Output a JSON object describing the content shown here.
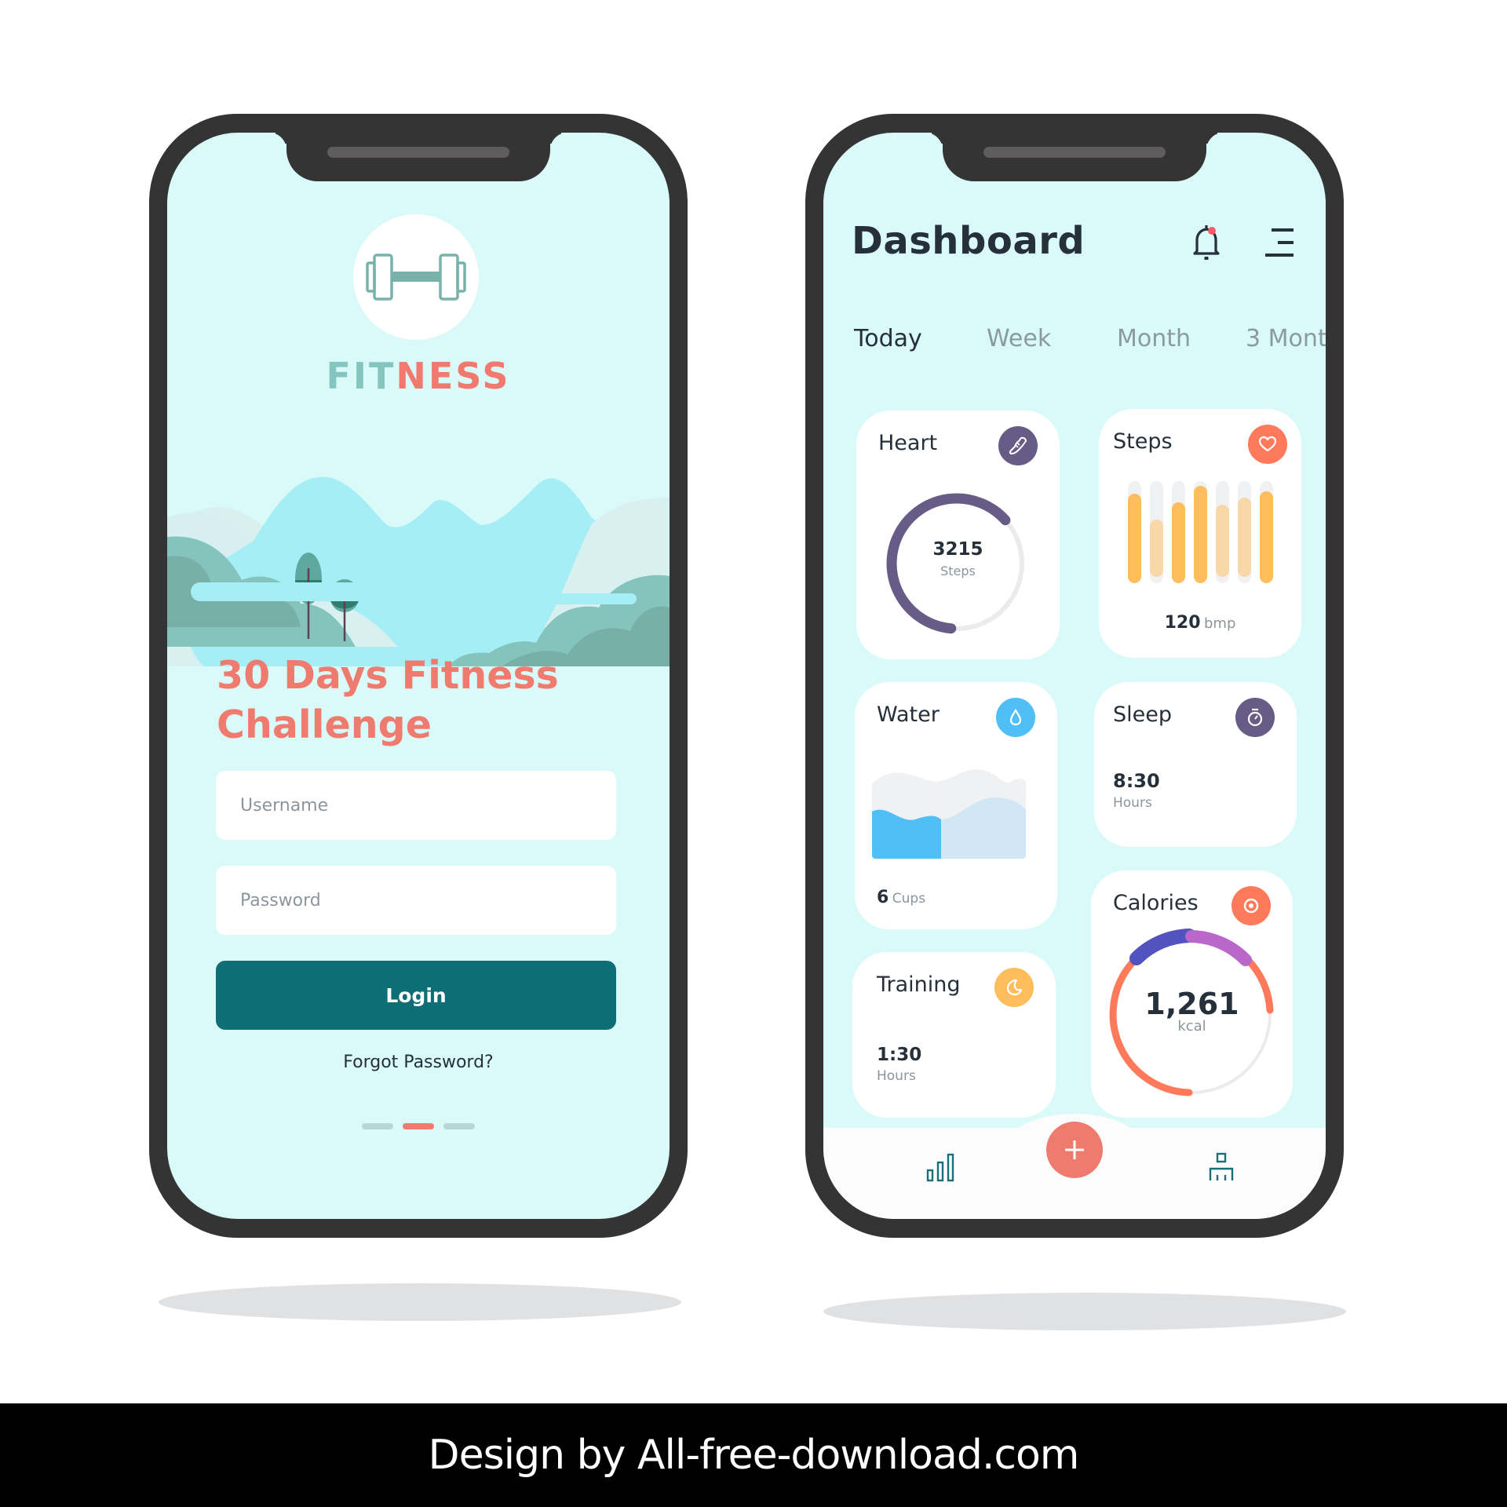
{
  "login_screen": {
    "brand": {
      "part1": "FIT",
      "part2": "NESS"
    },
    "logo_icon": "dumbbell-icon",
    "headline_line1": "30 Days Fitness",
    "headline_line2": "Challenge",
    "username_placeholder": "Username",
    "password_placeholder": "Password",
    "login_label": "Login",
    "forgot_label": "Forgot Password?",
    "pager": {
      "count": 3,
      "active_index": 1
    }
  },
  "dashboard": {
    "title": "Dashboard",
    "notification_icon": "bell-icon",
    "menu_icon": "menu-icon",
    "tabs": [
      {
        "label": "Today",
        "active": true
      },
      {
        "label": "Week",
        "active": false
      },
      {
        "label": "Month",
        "active": false
      },
      {
        "label": "3 Mont",
        "active": false
      }
    ],
    "cards": {
      "heart": {
        "title": "Heart",
        "icon": "shoe-icon",
        "value": "3215",
        "unit": "Steps",
        "progress": 0.62,
        "color": "#675c85"
      },
      "steps": {
        "title": "Steps",
        "icon": "heart-icon",
        "value": "120",
        "unit": "bmp",
        "color": "#ff7a5a",
        "bars": [
          0.88,
          0.62,
          0.79,
          0.95,
          0.77,
          0.84,
          0.9
        ],
        "bar_strong": [
          true,
          false,
          true,
          true,
          false,
          false,
          true
        ]
      },
      "water": {
        "title": "Water",
        "icon": "water-drop-icon",
        "value": "6",
        "unit": "Cups",
        "color": "#50bff6"
      },
      "sleep": {
        "title": "Sleep",
        "icon": "stopwatch-icon",
        "value": "8:30",
        "unit": "Hours",
        "color": "#675c85"
      },
      "calories": {
        "title": "Calories",
        "icon": "target-icon",
        "value": "1,261",
        "unit": "kcal",
        "color": "#ff7a5a"
      },
      "training": {
        "title": "Training",
        "icon": "moon-icon",
        "value": "1:30",
        "unit": "Hours",
        "color": "#ffbd5c"
      }
    },
    "bottom_nav": {
      "left_icon": "bar-chart-icon",
      "center_icon": "plus-icon",
      "right_icon": "org-chart-icon"
    }
  },
  "watermark": "Design by All-free-download.com"
}
